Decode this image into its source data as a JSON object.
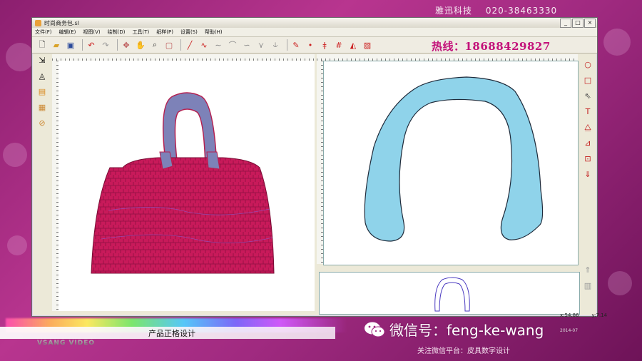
{
  "overlay": {
    "brand": "雅迅科技",
    "phone": "020-38463330",
    "hotline": "热线：18688429827",
    "caption": "产品正格设计",
    "video_brand": "VSANG VIDEO",
    "wechat_id": "微信号：feng-ke-wang",
    "follow_text": "关注微信平台：皮具数字设计",
    "date": "2014-07"
  },
  "window": {
    "title": "时尚商务包.sl",
    "menu": [
      "文件(F)",
      "编辑(E)",
      "视图(V)",
      "绘制(D)",
      "工具(T)",
      "纸样(P)",
      "设置(S)",
      "帮助(H)"
    ],
    "minimize": "_",
    "maximize": "□",
    "close": "×"
  },
  "status": {
    "x": "x:54.86",
    "y": "y:7.14"
  },
  "colors": {
    "bag_body": "#c81a5a",
    "bag_handle": "#7d82b8",
    "pattern_fill": "#8fd3ea",
    "hotline": "#c3127a"
  },
  "icons": {
    "toolbar": [
      "new-file-icon",
      "open-folder-icon",
      "save-icon",
      "undo-icon",
      "redo-icon",
      "pan-icon",
      "hand-icon",
      "zoom-icon",
      "fit-icon",
      "line-icon",
      "curve-icon",
      "wave-icon",
      "arc-icon",
      "spline-icon",
      "node-icon",
      "mirror-icon",
      "pen-icon",
      "point-icon",
      "pin-icon",
      "grid-icon",
      "triangle-icon",
      "hatch-icon"
    ],
    "left": [
      "select-icon",
      "grade-icon",
      "layer-icon",
      "color-icon",
      "measure-icon"
    ],
    "right": [
      "circle-icon",
      "rectangle-icon",
      "cursor-icon",
      "text-icon",
      "grade-icon",
      "dimension-icon",
      "frame-icon",
      "import-icon",
      "up-arrow-icon",
      "grid-icon"
    ]
  }
}
